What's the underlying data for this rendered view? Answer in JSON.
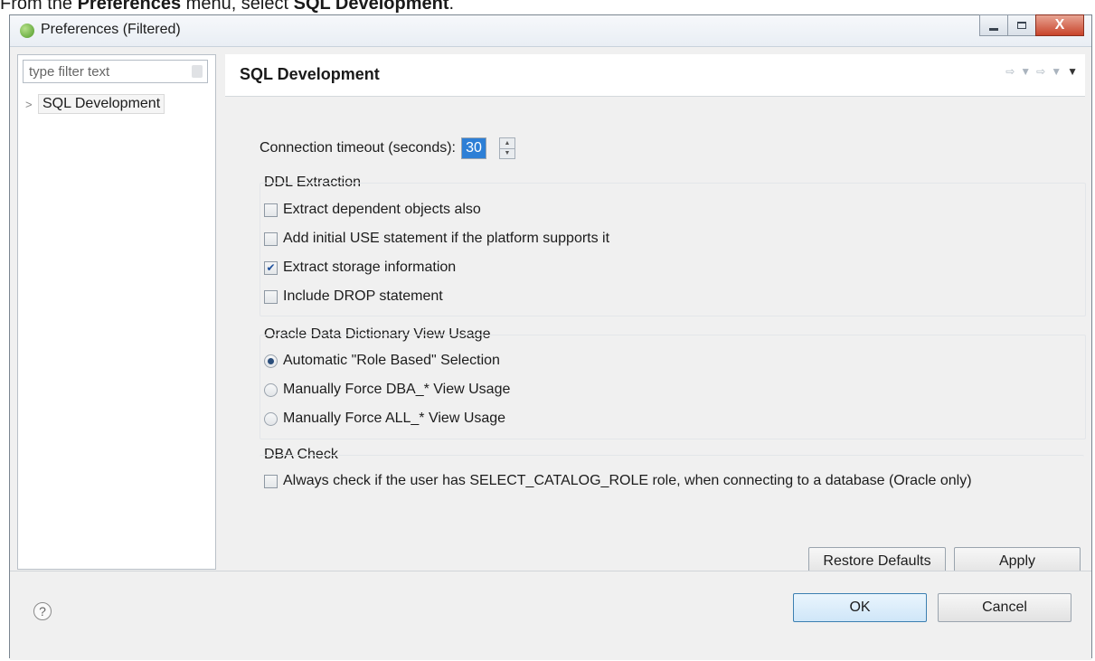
{
  "caption": {
    "prefix": "From the ",
    "menu_name": "Preferences",
    "middle": " menu, select ",
    "item_name": "SQL Development",
    "suffix": "."
  },
  "window": {
    "title": "Preferences (Filtered)",
    "controls": {
      "minimize": "minimize",
      "maximize": "maximize",
      "close": "X"
    }
  },
  "sidebar": {
    "filter_placeholder": "type filter text",
    "tree_items": [
      {
        "label": "SQL Development",
        "arrow": ">"
      }
    ]
  },
  "page": {
    "title": "SQL Development",
    "connection_timeout": {
      "label": "Connection timeout (seconds):",
      "value": "30"
    },
    "ddl_extraction": {
      "label": "DDL Extraction",
      "options": [
        {
          "label": "Extract dependent objects also",
          "checked": false
        },
        {
          "label": "Add initial USE statement if the platform supports it",
          "checked": false
        },
        {
          "label": "Extract storage information",
          "checked": true
        },
        {
          "label": "Include DROP statement",
          "checked": false
        }
      ]
    },
    "dictionary_view": {
      "label": "Oracle Data Dictionary View Usage",
      "options": [
        {
          "label": "Automatic \"Role Based\" Selection",
          "selected": true
        },
        {
          "label": "Manually Force DBA_* View Usage",
          "selected": false
        },
        {
          "label": "Manually Force ALL_* View Usage",
          "selected": false
        }
      ]
    },
    "dba_check": {
      "label": "DBA Check",
      "option": {
        "label": "Always check if the user has SELECT_CATALOG_ROLE role, when connecting to a database (Oracle only)",
        "checked": false
      }
    },
    "buttons": {
      "restore_defaults": "Restore Defaults",
      "apply": "Apply"
    }
  },
  "footer": {
    "help": "?",
    "ok": "OK",
    "cancel": "Cancel"
  }
}
